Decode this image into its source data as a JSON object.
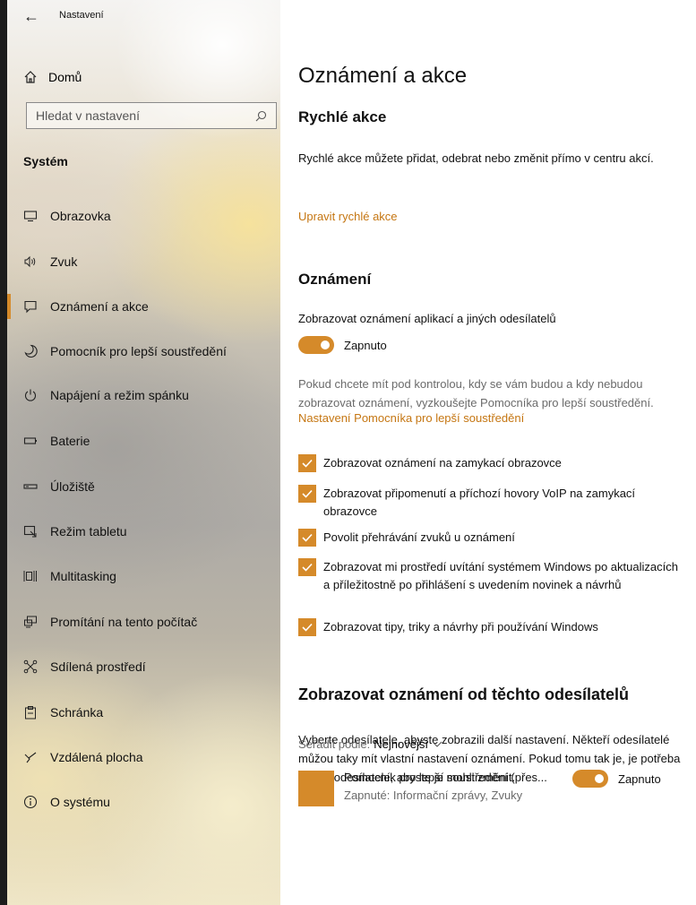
{
  "window": {
    "title": "Nastavení"
  },
  "sidebar": {
    "home_label": "Domů",
    "search_placeholder": "Hledat v nastavení",
    "section_title": "Systém",
    "items": [
      {
        "label": "Obrazovka",
        "icon": "monitor-icon"
      },
      {
        "label": "Zvuk",
        "icon": "speaker-icon"
      },
      {
        "label": "Oznámení a akce",
        "icon": "notification-icon",
        "active": true
      },
      {
        "label": "Pomocník pro lepší soustředění",
        "icon": "moon-icon"
      },
      {
        "label": "Napájení a režim spánku",
        "icon": "power-icon"
      },
      {
        "label": "Baterie",
        "icon": "battery-icon"
      },
      {
        "label": "Úložiště",
        "icon": "storage-icon"
      },
      {
        "label": "Režim tabletu",
        "icon": "tablet-icon"
      },
      {
        "label": "Multitasking",
        "icon": "multitasking-icon"
      },
      {
        "label": "Promítání na tento počítač",
        "icon": "projecting-icon"
      },
      {
        "label": "Sdílená prostředí",
        "icon": "shared-icon"
      },
      {
        "label": "Schránka",
        "icon": "clipboard-icon"
      },
      {
        "label": "Vzdálená plocha",
        "icon": "remote-desktop-icon"
      },
      {
        "label": "O systému",
        "icon": "info-icon"
      }
    ]
  },
  "main": {
    "title": "Oznámení a akce",
    "quick_actions": {
      "heading": "Rychlé akce",
      "text": "Rychlé akce můžete přidat, odebrat nebo změnit přímo v centru akcí.",
      "link": "Upravit rychlé akce"
    },
    "notifications": {
      "heading": "Oznámení",
      "toggle_label": "Zobrazovat oznámení aplikací a jiných odesílatelů",
      "toggle_state": "Zapnuto",
      "info_text": "Pokud chcete mít pod kontrolou, kdy se vám budou a kdy nebudou zobrazovat oznámení, vyzkoušejte Pomocníka pro lepší soustředění.",
      "info_link": "Nastavení Pomocníka pro lepší soustředění",
      "checkboxes": [
        {
          "label": "Zobrazovat oznámení na zamykací obrazovce",
          "checked": true
        },
        {
          "label": "Zobrazovat připomenutí a příchozí hovory VoIP na zamykací obrazovce",
          "checked": true
        },
        {
          "label": "Povolit přehrávání zvuků u oznámení",
          "checked": true
        },
        {
          "label": "Zobrazovat mi prostředí uvítání systémem Windows po aktualizacích a příležitostně po přihlášení s uvedením novinek a návrhů",
          "checked": true
        },
        {
          "label": "Zobrazovat tipy, triky a návrhy při používání Windows",
          "checked": true
        }
      ]
    },
    "senders": {
      "heading": "Zobrazovat oznámení od těchto odesílatelů",
      "text": "Vyberte odesílatele, abyste zobrazili další nastavení. Někteří odesílatelé můžou taky mít vlastní nastavení oznámení. Pokud tomu tak je, je potřeba otevřít odesílatele, abyste je mohli změnit.",
      "sort_label": "Seřadit podle:",
      "sort_value": "Nejnovější",
      "items": [
        {
          "name": "Pomocník pro lepší soustředění (přes...",
          "detail": "Zapnuté: Informační zprávy, Zvuky",
          "state": "Zapnuto"
        }
      ]
    }
  },
  "colors": {
    "accent": "#d58a2a",
    "link": "#c57612"
  }
}
